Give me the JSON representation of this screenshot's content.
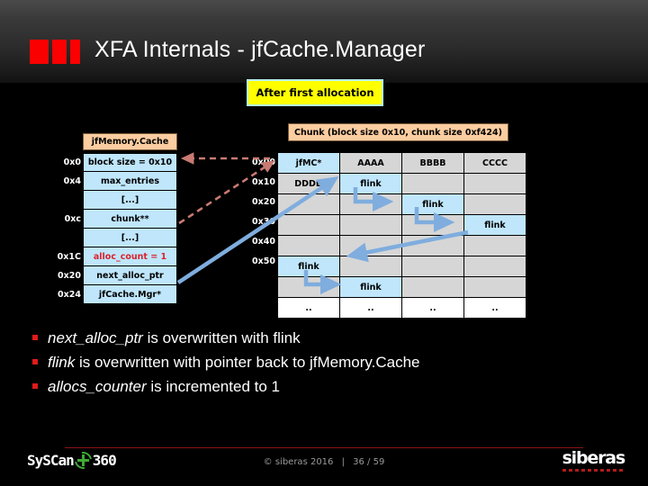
{
  "slide": {
    "title": "XFA Internals - jfCache.Manager",
    "callout": "After first allocation",
    "accent_red": "#fb0000",
    "highlight_blue": "#bfe6fb",
    "header_peach": "#fbcda0"
  },
  "left_struct": {
    "header": "jfMemory.Cache",
    "rows": [
      {
        "offset": "0x0",
        "label": "block size = 0x10",
        "style": "normal"
      },
      {
        "offset": "0x4",
        "label": "max_entries",
        "style": "normal"
      },
      {
        "offset": "",
        "label": "[...]",
        "style": "normal"
      },
      {
        "offset": "0xc",
        "label": "chunk**",
        "style": "normal"
      },
      {
        "offset": "",
        "label": "[...]",
        "style": "normal"
      },
      {
        "offset": "0x1C",
        "label": "alloc_count = 1",
        "style": "alloc"
      },
      {
        "offset": "0x20",
        "label": "next_alloc_ptr",
        "style": "normal"
      },
      {
        "offset": "0x24",
        "label": "jfCache.Mgr*",
        "style": "normal"
      }
    ]
  },
  "chunk_table": {
    "header": "Chunk (block size 0x10, chunk size 0xf424)",
    "offsets": [
      "0x00",
      "0x10",
      "0x20",
      "0x30",
      "0x40",
      "0x50",
      "",
      ""
    ],
    "rows": [
      [
        {
          "t": "jfMC*",
          "h": true
        },
        {
          "t": "AAAA",
          "h": false
        },
        {
          "t": "BBBB",
          "h": false
        },
        {
          "t": "CCCC",
          "h": false
        }
      ],
      [
        {
          "t": "DDDD",
          "h": false
        },
        {
          "t": "flink",
          "h": true
        },
        {
          "t": "",
          "h": false
        },
        {
          "t": "",
          "h": false
        }
      ],
      [
        {
          "t": "",
          "h": false
        },
        {
          "t": "",
          "h": false
        },
        {
          "t": "flink",
          "h": true
        },
        {
          "t": "",
          "h": false
        }
      ],
      [
        {
          "t": "",
          "h": false
        },
        {
          "t": "",
          "h": false
        },
        {
          "t": "",
          "h": false
        },
        {
          "t": "flink",
          "h": true
        }
      ],
      [
        {
          "t": "",
          "h": false
        },
        {
          "t": "",
          "h": false
        },
        {
          "t": "",
          "h": false
        },
        {
          "t": "",
          "h": false
        }
      ],
      [
        {
          "t": "flink",
          "h": true
        },
        {
          "t": "",
          "h": false
        },
        {
          "t": "",
          "h": false
        },
        {
          "t": "",
          "h": false
        }
      ],
      [
        {
          "t": "",
          "h": false
        },
        {
          "t": "flink",
          "h": true
        },
        {
          "t": "",
          "h": false
        },
        {
          "t": "",
          "h": false
        }
      ],
      [
        {
          "t": "..",
          "h": false,
          "blank": true
        },
        {
          "t": "..",
          "h": false,
          "blank": true
        },
        {
          "t": "..",
          "h": false,
          "blank": true
        },
        {
          "t": "..",
          "h": false,
          "blank": true
        }
      ]
    ]
  },
  "bullets": [
    {
      "em": "next_alloc_ptr",
      "rest": " is overwritten with flink"
    },
    {
      "em": "flink",
      "rest": " is overwritten with pointer back to jfMemory.Cache"
    },
    {
      "em": "allocs_counter",
      "rest": " is incremented to 1"
    }
  ],
  "footer": {
    "copyright": "© siberas 2016",
    "separator": "|",
    "page": "36 / 59",
    "logo_left_text": "SySCan",
    "logo_left_suffix": "360",
    "logo_right_text": "siberas"
  }
}
